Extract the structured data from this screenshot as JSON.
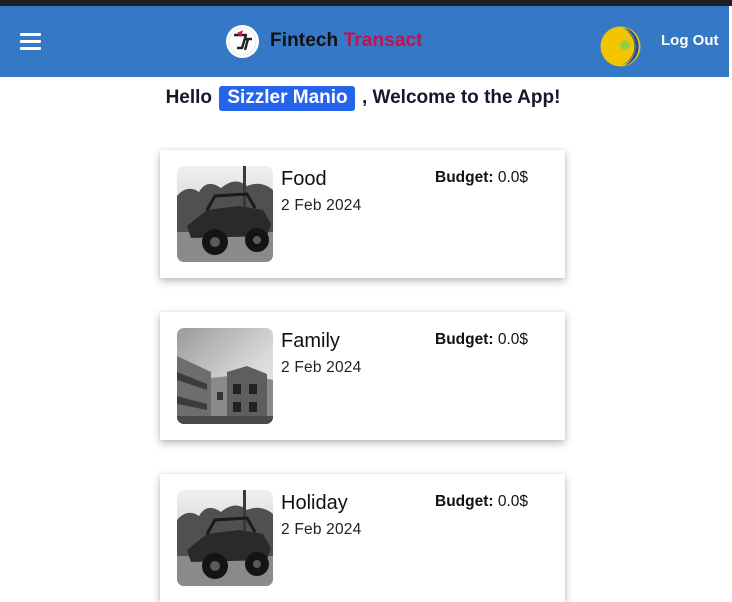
{
  "header": {
    "brand_first": "Fintech",
    "brand_second": "Transact",
    "logout_label": "Log Out",
    "bg_color": "#3478c6",
    "brand_accent_color": "#c2124f"
  },
  "greeting": {
    "prefix": "Hello",
    "username": "Sizzler Manio",
    "suffix": ", Welcome to the App!"
  },
  "budget_label": "Budget:",
  "categories": [
    {
      "title": "Food",
      "date": "2 Feb 2024",
      "budget": "0.0$",
      "image": "offroad-buggy-photo"
    },
    {
      "title": "Family",
      "date": "2 Feb 2024",
      "budget": "0.0$",
      "image": "house-building-photo"
    },
    {
      "title": "Holiday",
      "date": "2 Feb 2024",
      "budget": "0.0$",
      "image": "offroad-buggy-photo"
    }
  ]
}
